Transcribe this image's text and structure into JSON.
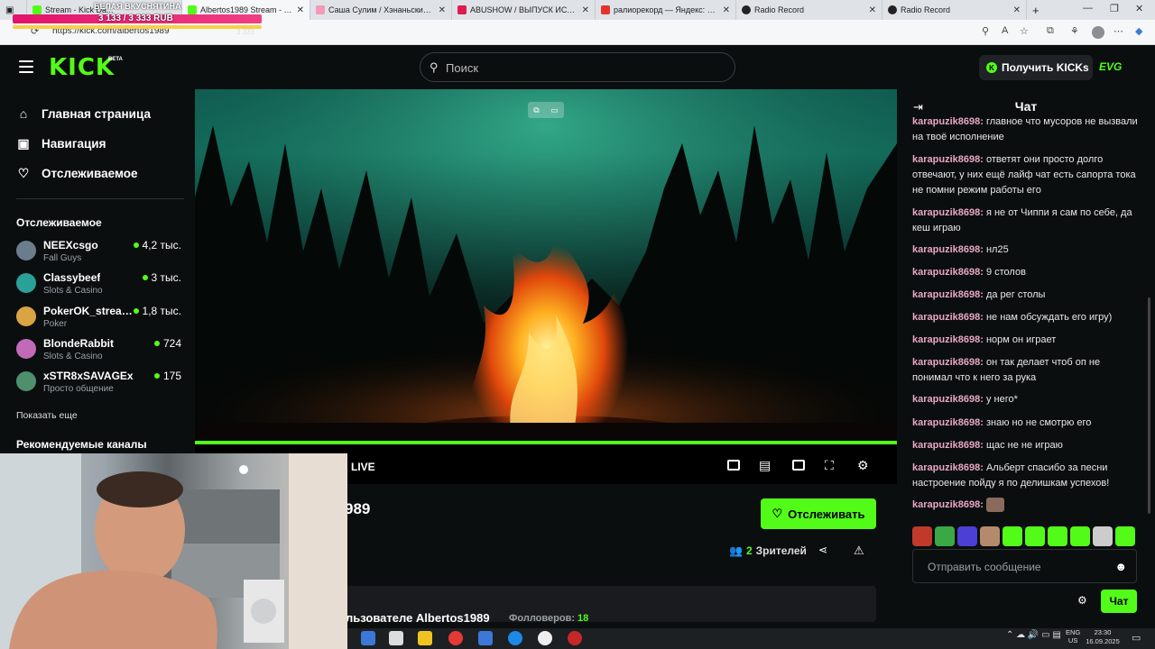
{
  "browser": {
    "tabs": [
      {
        "label": "Stream - Kick Da...",
        "color": "#53fc18",
        "active": false
      },
      {
        "label": "Albertos1989 Stream - Watc",
        "color": "#53fc18",
        "active": true
      },
      {
        "label": "Саша Сулим / Хэнаньский Чика",
        "color": "#f59ab6",
        "active": false
      },
      {
        "label": "ABUSHOW / ВЫПУСК ИСТОРИЙ",
        "color": "#e01b4f",
        "active": false
      },
      {
        "label": "ралиорекорд — Яндекс: нашлос",
        "color": "#e5322d",
        "active": false
      },
      {
        "label": "Radio Record",
        "color": "#222",
        "active": false
      },
      {
        "label": "Radio Record",
        "color": "#222",
        "active": false
      }
    ],
    "url": "https://kick.com/albertos1989"
  },
  "donation": {
    "title": "БЕЛАЯ ВКУСНЯТИНА",
    "amount": "3 133 / 3 333 RUB",
    "amount_small": "3 333"
  },
  "header": {
    "logo": "KICK",
    "logo_badge": "BETA",
    "search_placeholder": "Поиск",
    "get_kicks": "Получить KICKs",
    "user": "EVG"
  },
  "sidebar": {
    "nav": [
      {
        "label": "Главная страница",
        "icon": "home-icon"
      },
      {
        "label": "Навигация",
        "icon": "browse-icon"
      },
      {
        "label": "Отслеживаемое",
        "icon": "heart-icon"
      }
    ],
    "followed_heading": "Отслеживаемое",
    "channels": [
      {
        "name": "NEEXcsgo",
        "category": "Fall Guys",
        "viewers": "4,2 тыс.",
        "avatar": "#6b7d8c"
      },
      {
        "name": "Classybeef",
        "category": "Slots & Casino",
        "viewers": "3 тыс.",
        "avatar": "#2aa198"
      },
      {
        "name": "PokerOK_stream...",
        "category": "Poker",
        "viewers": "1,8 тыс.",
        "avatar": "#d9a441"
      },
      {
        "name": "BlondeRabbit",
        "category": "Slots & Casino",
        "viewers": "724",
        "avatar": "#c06ab8"
      },
      {
        "name": "xSTR8xSAVAGEx",
        "category": "Просто общение",
        "viewers": "175",
        "avatar": "#4e8f6e"
      }
    ],
    "show_more": "Показать еще",
    "recommended_heading": "Рекомендуемые каналы"
  },
  "player": {
    "live_label": "LIVE",
    "progress": 1.0
  },
  "stream": {
    "name_visible": "989",
    "follow_label": "Отслеживать",
    "viewers_count": "2",
    "viewers_label": "Зрителей",
    "about_title": "льзователе Albertos1989",
    "followers_label": "Фолловеров:",
    "followers_count": "18"
  },
  "chat": {
    "title": "Чат",
    "messages": [
      {
        "user": "karapuzik8698:",
        "text": "главное что мусоров не вызвали на твоё исполнение"
      },
      {
        "user": "karapuzik8698:",
        "text": "ответят они просто долго отвечают, у них ещё лайф чат есть сапорта тока не помни режим работы его"
      },
      {
        "user": "karapuzik8698:",
        "text": "я не от Чиппи я сам по себе, да кеш играю"
      },
      {
        "user": "karapuzik8698:",
        "text": "нл25"
      },
      {
        "user": "karapuzik8698:",
        "text": "9 столов"
      },
      {
        "user": "karapuzik8698:",
        "text": "да рег столы"
      },
      {
        "user": "karapuzik8698:",
        "text": "не нам обсуждать его игру)"
      },
      {
        "user": "karapuzik8698:",
        "text": "норм он играет"
      },
      {
        "user": "karapuzik8698:",
        "text": "он так делает чтоб оп не понимал что к него за рука"
      },
      {
        "user": "karapuzik8698:",
        "text": "у него*"
      },
      {
        "user": "karapuzik8698:",
        "text": "знаю но не смотрю его"
      },
      {
        "user": "karapuzik8698:",
        "text": "щас не не играю"
      },
      {
        "user": "karapuzik8698:",
        "text": "Альберт спасибо за песни настроение пойду я по делишкам успехов!"
      },
      {
        "user": "karapuzik8698:",
        "text": ""
      }
    ],
    "emote_colors": [
      "#c0392b",
      "#3aa845",
      "#4b3fd6",
      "#b38a6a",
      "#53fc18",
      "#53fc18",
      "#53fc18",
      "#53fc18",
      "#cccccc",
      "#53fc18"
    ],
    "input_placeholder": "Отправить сообщение",
    "send_label": "Чат"
  },
  "taskbar": {
    "lang_top": "ENG",
    "lang_bottom": "US",
    "time": "23:30",
    "date": "16.09.2025"
  }
}
